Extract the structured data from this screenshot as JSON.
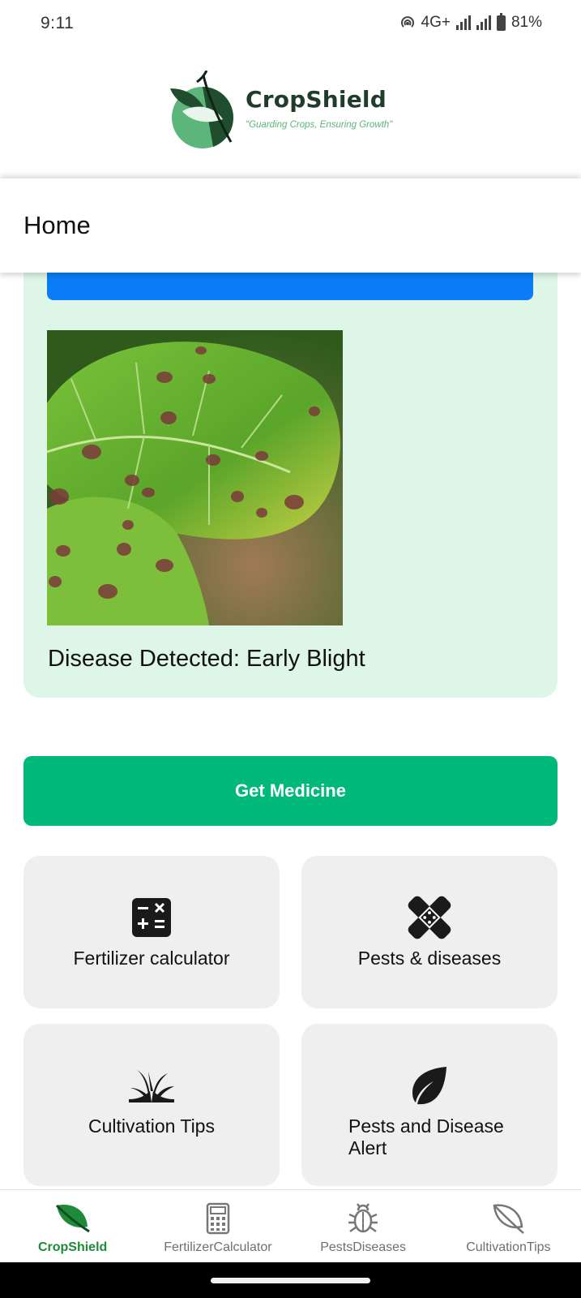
{
  "status_bar": {
    "time": "9:11",
    "network": "4G+",
    "battery": "81%"
  },
  "logo": {
    "name": "CropShield",
    "tagline": "\"Guarding Crops, Ensuring Growth\""
  },
  "header": {
    "title": "Home"
  },
  "result": {
    "image_alt": "leaf with early blight spots",
    "text": "Disease Detected: Early Blight"
  },
  "actions": {
    "get_medicine": "Get Medicine"
  },
  "tiles": [
    {
      "label": "Fertilizer calculator",
      "icon": "calculator-icon"
    },
    {
      "label": "Pests & diseases",
      "icon": "bandage-icon"
    },
    {
      "label": "Cultivation Tips",
      "icon": "grass-icon"
    },
    {
      "label": "Pests and Disease Alert",
      "icon": "leaf-icon"
    }
  ],
  "bottom_nav": [
    {
      "label": "CropShield",
      "icon": "leaf-icon",
      "active": true
    },
    {
      "label": "FertilizerCalculator",
      "icon": "calculator-icon",
      "active": false
    },
    {
      "label": "PestsDiseases",
      "icon": "bug-icon",
      "active": false
    },
    {
      "label": "CultivationTips",
      "icon": "leaf-outline-icon",
      "active": false
    }
  ],
  "colors": {
    "primary_blue": "#0a7cf6",
    "accent_green": "#00b87a",
    "card_bg": "#ddf6e7",
    "tile_bg": "#efefef",
    "nav_active": "#1e8a3a"
  }
}
